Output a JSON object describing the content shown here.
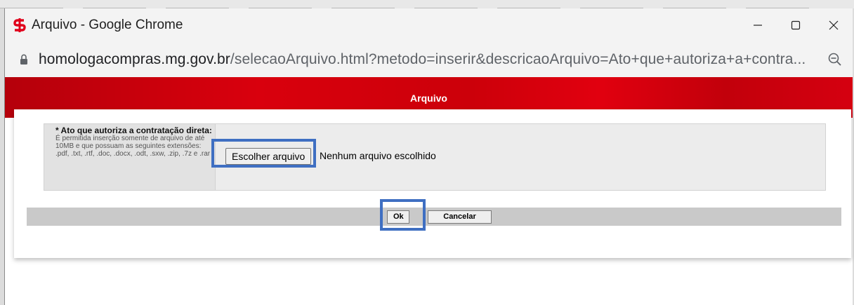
{
  "window": {
    "title": "Arquivo - Google Chrome",
    "controls": {
      "minimize": "—",
      "maximize": "☐",
      "close": "✕"
    }
  },
  "address": {
    "host": "homologacompras.mg.gov.br",
    "path": "/selecaoArquivo.html?metodo=inserir&descricaoArquivo=Ato+que+autoriza+a+contra..."
  },
  "header": {
    "title": "Arquivo"
  },
  "form": {
    "field_label": "* Ato que autoriza a contratação direta:",
    "help_text": "É permitida inserção somente de arquivo de até 10MB e que possuam as seguintes extensões: .pdf, .txt, .rtf, .doc, .docx, .odt, .sxw, .zip, .7z e .rar .",
    "file_button": "Escolher arquivo",
    "file_status": "Nenhum arquivo escolhido"
  },
  "actions": {
    "ok": "Ok",
    "cancel": "Cancelar"
  },
  "icons": {
    "app": "sefaz-logo-icon",
    "lock": "lock-icon",
    "zoom": "zoom-out-icon"
  },
  "colors": {
    "header_red": "#d9000d",
    "highlight_blue": "#3f6fc2",
    "button_bar": "#c9c9c9"
  }
}
